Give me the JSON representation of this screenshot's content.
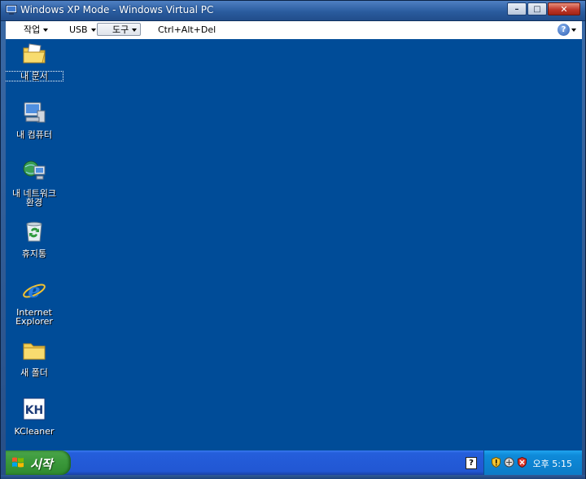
{
  "window": {
    "title": "Windows XP Mode - Windows Virtual PC",
    "controls": {
      "minimize": "–",
      "maximize": "□",
      "close": "✕"
    }
  },
  "toolbar": {
    "items": [
      {
        "label": "작업",
        "dropdown": true
      },
      {
        "label": "USB",
        "dropdown": true
      },
      {
        "label": "도구",
        "dropdown": true,
        "pressed": true
      },
      {
        "label": "Ctrl+Alt+Del",
        "dropdown": false
      }
    ],
    "help": "?"
  },
  "desktop": {
    "background": "#004c98",
    "icons": [
      {
        "label": "내 문서",
        "icon": "my-documents-folder",
        "selected": true
      },
      {
        "label": "내 컴퓨터",
        "icon": "my-computer"
      },
      {
        "label": "내 네트워크\n환경",
        "icon": "my-network-places"
      },
      {
        "label": "휴지통",
        "icon": "recycle-bin"
      },
      {
        "label": "Internet\nExplorer",
        "icon": "internet-explorer"
      },
      {
        "label": "새 폴더",
        "icon": "folder"
      },
      {
        "label": "KCleaner",
        "icon": "kcleaner-kh"
      }
    ]
  },
  "taskbar": {
    "start_label": "시작",
    "help_label": "?",
    "tray": {
      "clock": "오후 5:15"
    }
  }
}
